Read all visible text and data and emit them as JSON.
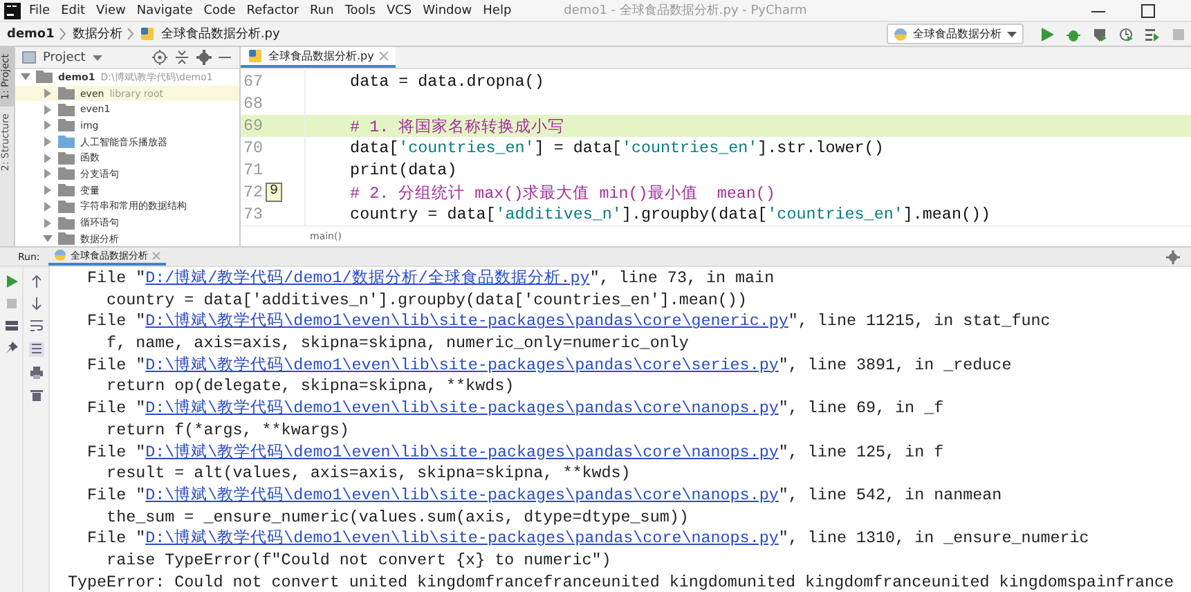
{
  "menu_bar": {
    "items": [
      "File",
      "Edit",
      "View",
      "Navigate",
      "Code",
      "Refactor",
      "Run",
      "Tools",
      "VCS",
      "Window",
      "Help"
    ],
    "title": "demo1 - 全球食品数据分析.py - PyCharm"
  },
  "navigation_bar": {
    "breadcrumbs": [
      "demo1",
      "数据分析",
      "全球食品数据分析.py"
    ],
    "run_configuration": "全球食品数据分析"
  },
  "side_tabs": [
    {
      "label": "1: Project",
      "selected": true
    },
    {
      "label": "2: Structure",
      "selected": false
    }
  ],
  "project_panel": {
    "title": "Project",
    "tree": [
      {
        "name": "demo1",
        "note": "D:\\博斌\\教学代码\\demo1",
        "kind": "folder",
        "expanded": true,
        "selected": false,
        "children": [
          {
            "name": "even",
            "note": "library root",
            "kind": "folder",
            "expanded": false,
            "selected": true
          },
          {
            "name": "even1",
            "kind": "folder",
            "expanded": false,
            "selected": false
          },
          {
            "name": "img",
            "kind": "folder",
            "expanded": false,
            "selected": false
          },
          {
            "name": "人工智能音乐播放器",
            "kind": "source",
            "expanded": false,
            "selected": false
          },
          {
            "name": "函数",
            "kind": "folder",
            "expanded": false,
            "selected": false
          },
          {
            "name": "分支语句",
            "kind": "folder",
            "expanded": false,
            "selected": false
          },
          {
            "name": "变量",
            "kind": "folder",
            "expanded": false,
            "selected": false
          },
          {
            "name": "字符串和常用的数据结构",
            "kind": "folder",
            "expanded": false,
            "selected": false
          },
          {
            "name": "循环语句",
            "kind": "folder",
            "expanded": false,
            "selected": false
          },
          {
            "name": "数据分析",
            "kind": "folder",
            "expanded": true,
            "selected": false
          }
        ]
      }
    ]
  },
  "editor": {
    "tab": "全球食品数据分析.py",
    "lines": [
      {
        "number": "67",
        "current": false,
        "tokens": [
          {
            "kind": "plain",
            "text": "    data = data.dropna()"
          }
        ]
      },
      {
        "number": "68",
        "current": false
      },
      {
        "number": "69",
        "current": true,
        "tokens": [
          {
            "kind": "comment",
            "text": "    # 1. 将国家名称转换成小写"
          }
        ]
      },
      {
        "number": "70",
        "current": false,
        "tokens": [
          {
            "kind": "plain",
            "text": "    data["
          },
          {
            "kind": "string",
            "text": "'countries_en'"
          },
          {
            "kind": "plain",
            "text": "] = data["
          },
          {
            "kind": "string",
            "text": "'countries_en'"
          },
          {
            "kind": "plain",
            "text": "].str.lower()"
          }
        ]
      },
      {
        "number": "71",
        "current": false,
        "tokens": [
          {
            "kind": "plain",
            "text": "    print(data)"
          }
        ]
      },
      {
        "number": "72",
        "current": false,
        "bookmark": "9",
        "tokens": [
          {
            "kind": "comment",
            "text": "    # 2. 分组统计 max()求最大值 min()最小值  mean()"
          }
        ]
      },
      {
        "number": "73",
        "current": false,
        "tokens": [
          {
            "kind": "plain",
            "text": "    country = data["
          },
          {
            "kind": "string",
            "text": "'additives_n'"
          },
          {
            "kind": "plain",
            "text": "].groupby(data["
          },
          {
            "kind": "string",
            "text": "'countries_en'"
          },
          {
            "kind": "plain",
            "text": "].mean())"
          }
        ]
      }
    ],
    "breadcrumb": "main()"
  },
  "run_panel": {
    "label": "Run:",
    "tab": "全球食品数据分析",
    "console": [
      [
        {
          "kind": "plain",
          "text": "  File \""
        },
        {
          "kind": "link",
          "text": "D:/博斌/教学代码/demo1/数据分析/全球食品数据分析.py"
        },
        {
          "kind": "plain",
          "text": "\", line 73, in main"
        }
      ],
      [
        {
          "kind": "plain",
          "text": "    country = data['additives_n'].groupby(data['countries_en'].mean())"
        }
      ],
      [
        {
          "kind": "plain",
          "text": "  File \""
        },
        {
          "kind": "link",
          "text": "D:\\博斌\\教学代码\\demo1\\even\\lib\\site-packages\\pandas\\core\\generic.py"
        },
        {
          "kind": "plain",
          "text": "\", line 11215, in stat_func"
        }
      ],
      [
        {
          "kind": "plain",
          "text": "    f, name, axis=axis, skipna=skipna, numeric_only=numeric_only"
        }
      ],
      [
        {
          "kind": "plain",
          "text": "  File \""
        },
        {
          "kind": "link",
          "text": "D:\\博斌\\教学代码\\demo1\\even\\lib\\site-packages\\pandas\\core\\series.py"
        },
        {
          "kind": "plain",
          "text": "\", line 3891, in _reduce"
        }
      ],
      [
        {
          "kind": "plain",
          "text": "    return op(delegate, skipna=skipna, **kwds)"
        }
      ],
      [
        {
          "kind": "plain",
          "text": "  File \""
        },
        {
          "kind": "link",
          "text": "D:\\博斌\\教学代码\\demo1\\even\\lib\\site-packages\\pandas\\core\\nanops.py"
        },
        {
          "kind": "plain",
          "text": "\", line 69, in _f"
        }
      ],
      [
        {
          "kind": "plain",
          "text": "    return f(*args, **kwargs)"
        }
      ],
      [
        {
          "kind": "plain",
          "text": "  File \""
        },
        {
          "kind": "link",
          "text": "D:\\博斌\\教学代码\\demo1\\even\\lib\\site-packages\\pandas\\core\\nanops.py"
        },
        {
          "kind": "plain",
          "text": "\", line 125, in f"
        }
      ],
      [
        {
          "kind": "plain",
          "text": "    result = alt(values, axis=axis, skipna=skipna, **kwds)"
        }
      ],
      [
        {
          "kind": "plain",
          "text": "  File \""
        },
        {
          "kind": "link",
          "text": "D:\\博斌\\教学代码\\demo1\\even\\lib\\site-packages\\pandas\\core\\nanops.py"
        },
        {
          "kind": "plain",
          "text": "\", line 542, in nanmean"
        }
      ],
      [
        {
          "kind": "plain",
          "text": "    the_sum = _ensure_numeric(values.sum(axis, dtype=dtype_sum))"
        }
      ],
      [
        {
          "kind": "plain",
          "text": "  File \""
        },
        {
          "kind": "link",
          "text": "D:\\博斌\\教学代码\\demo1\\even\\lib\\site-packages\\pandas\\core\\nanops.py"
        },
        {
          "kind": "plain",
          "text": "\", line 1310, in _ensure_numeric"
        }
      ],
      [
        {
          "kind": "plain",
          "text": "    raise TypeError(f\"Could not convert {x} to numeric\")"
        }
      ],
      [
        {
          "kind": "plain",
          "text": "TypeError: Could not convert united kingdomfrancefranceunited kingdomunited kingdomfranceunited kingdomspainfrance"
        }
      ]
    ]
  }
}
